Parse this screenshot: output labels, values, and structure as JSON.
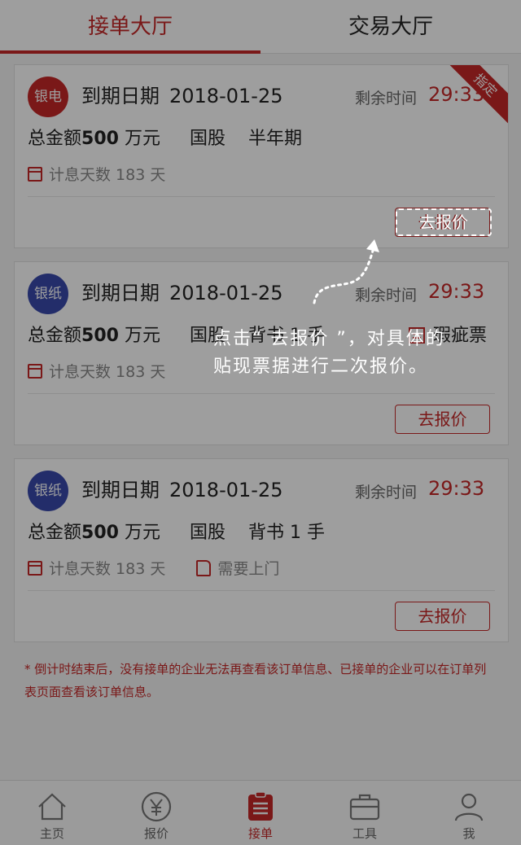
{
  "tabs": [
    {
      "label": "接单大厅",
      "active": true
    },
    {
      "label": "交易大厅",
      "active": false
    }
  ],
  "cards": [
    {
      "badge": "银电",
      "badge_color": "#c62828",
      "due_label": "到期日期",
      "due_date": "2018-01-25",
      "remain_label": "剩余时间",
      "remain_time": "29:33",
      "amount_prefix": "总金额",
      "amount_value": "500",
      "amount_unit": "万元",
      "tag1": "国股",
      "tag2": "半年期",
      "interest_days": "计息天数 183 天",
      "button": "去报价",
      "ribbon": "指定"
    },
    {
      "badge": "银纸",
      "badge_color": "#3949ab",
      "due_label": "到期日期",
      "due_date": "2018-01-25",
      "remain_label": "剩余时间",
      "remain_time": "29:33",
      "amount_prefix": "总金额",
      "amount_value": "500",
      "amount_unit": "万元",
      "tag1": "国股",
      "tag2": "背书 1 手",
      "flag": "瑕疵票",
      "interest_days": "计息天数 183 天",
      "button": "去报价"
    },
    {
      "badge": "银纸",
      "badge_color": "#3949ab",
      "due_label": "到期日期",
      "due_date": "2018-01-25",
      "remain_label": "剩余时间",
      "remain_time": "29:33",
      "amount_prefix": "总金额",
      "amount_value": "500",
      "amount_unit": "万元",
      "tag1": "国股",
      "tag2": "背书 1 手",
      "interest_days": "计息天数 183 天",
      "extra": "需要上门",
      "button": "去报价"
    }
  ],
  "note": "* 倒计时结束后，没有接单的企业无法再查看该订单信息、已接单的企业可以在订单列表页面查看该订单信息。",
  "overlay": {
    "highlight_button": "去报价",
    "tip": "点击“ 去报价 ”，对具体的贴现票据进行二次报价。"
  },
  "bottom_nav": [
    {
      "label": "主页",
      "icon": "home-icon"
    },
    {
      "label": "报价",
      "icon": "yen-icon"
    },
    {
      "label": "接单",
      "icon": "clipboard-icon",
      "active": true
    },
    {
      "label": "工具",
      "icon": "toolbox-icon"
    },
    {
      "label": "我",
      "icon": "user-icon"
    }
  ],
  "colors": {
    "accent": "#c62828",
    "blue_badge": "#3949ab"
  }
}
